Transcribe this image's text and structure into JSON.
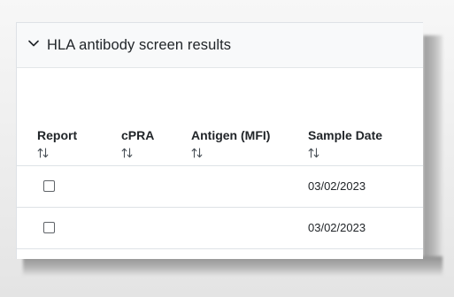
{
  "panel": {
    "title": "HLA antibody screen results",
    "toggle_icon": "chevron-down-icon"
  },
  "table": {
    "sort_icon": "sort-arrows-icon",
    "columns": [
      {
        "label": "Report"
      },
      {
        "label": "cPRA"
      },
      {
        "label": "Antigen (MFI)"
      },
      {
        "label": "Sample Date"
      }
    ],
    "rows": [
      {
        "report_checked": false,
        "cpra": "",
        "antigen": "",
        "sample_date": "03/02/2023"
      },
      {
        "report_checked": false,
        "cpra": "",
        "antigen": "",
        "sample_date": "03/02/2023"
      }
    ]
  }
}
